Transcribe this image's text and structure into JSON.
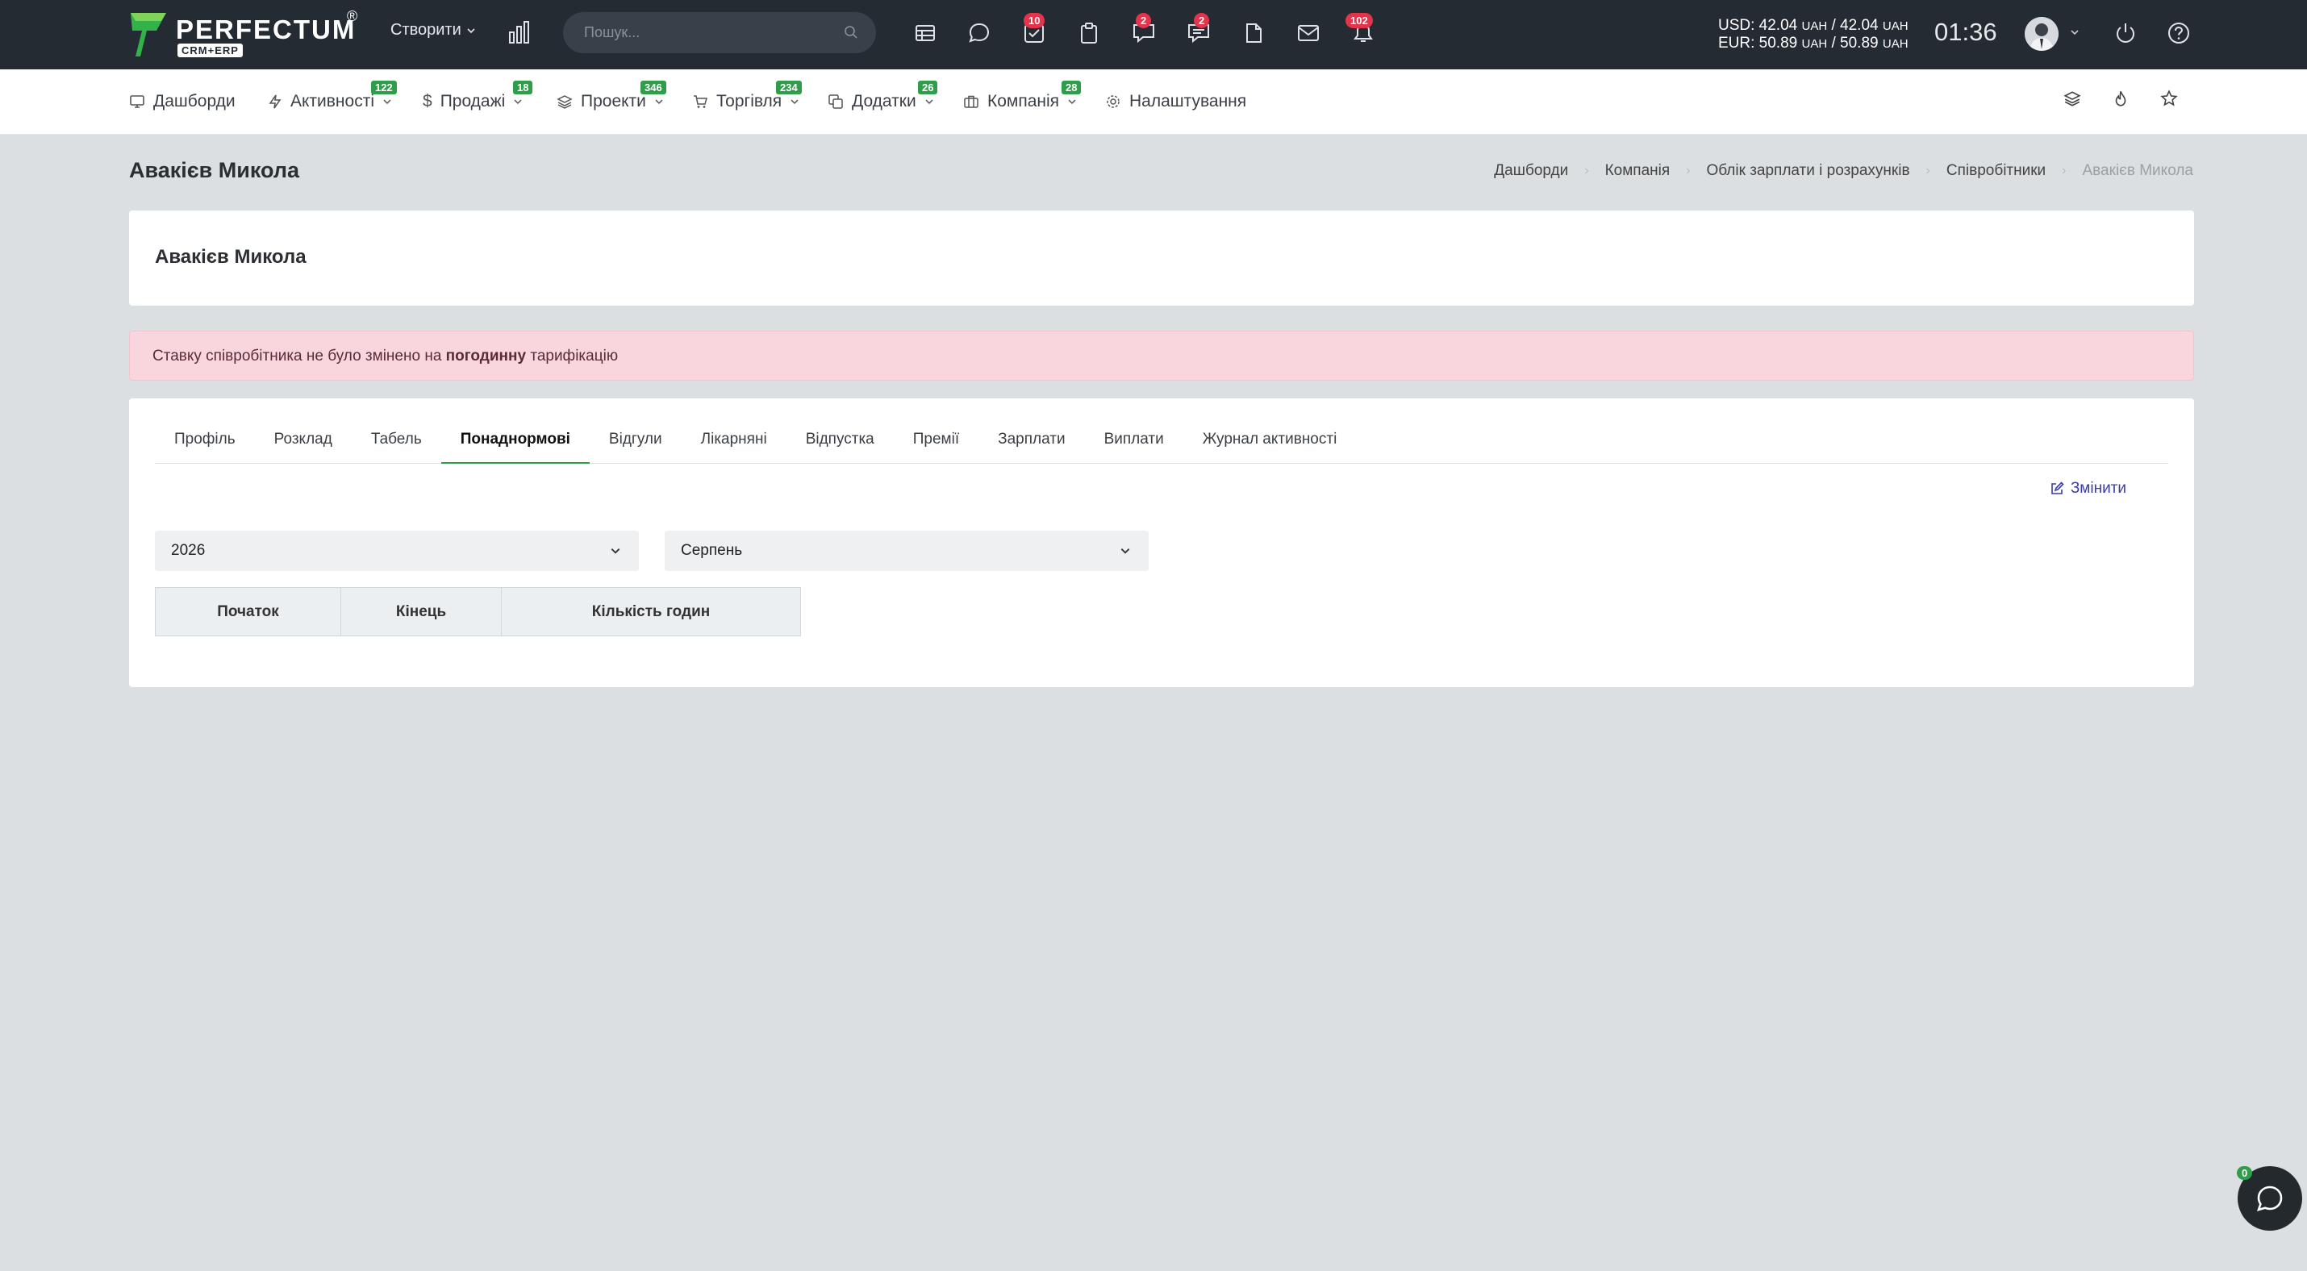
{
  "app": {
    "logo_text": "PERFECTUM",
    "logo_sub": "CRM+ERP",
    "logo_reg": "®",
    "create_label": "Створити",
    "search_placeholder": "Пошук...",
    "badges": {
      "tasks": "10",
      "messages": "2",
      "chat": "2",
      "notifications": "102"
    },
    "rates": {
      "usd_label": "USD: 42.04",
      "usd_unit1": "UAH",
      "usd_sep": "/ 42.04",
      "usd_unit2": "UAH",
      "eur_label": "EUR: 50.89",
      "eur_unit1": "UAH",
      "eur_sep": "/ 50.89",
      "eur_unit2": "UAH"
    },
    "time": "01:36",
    "colors": {
      "topbar": "#242b33",
      "accent_green": "#2e9e4a",
      "badge_red": "#e5334b"
    }
  },
  "nav": [
    {
      "label": "Дашборди",
      "icon": "monitor-icon",
      "badge": ""
    },
    {
      "label": "Активності",
      "icon": "bolt-icon",
      "badge": "122"
    },
    {
      "label": "Продажі",
      "icon": "dollar-icon",
      "badge": "18"
    },
    {
      "label": "Проекти",
      "icon": "layers-icon",
      "badge": "346"
    },
    {
      "label": "Торгівля",
      "icon": "cart-icon",
      "badge": "234"
    },
    {
      "label": "Додатки",
      "icon": "copy-icon",
      "badge": "26"
    },
    {
      "label": "Компанія",
      "icon": "briefcase-icon",
      "badge": "28"
    },
    {
      "label": "Налаштування",
      "icon": "gear-icon",
      "badge": ""
    }
  ],
  "page": {
    "title": "Авакієв Микола",
    "breadcrumb": [
      "Дашборди",
      "Компанія",
      "Облік зарплати і розрахунків",
      "Співробітники",
      "Авакієв Микола"
    ],
    "card_name": "Авакієв Микола",
    "alert": {
      "before": "Ставку співробітника не було змінено на ",
      "bold": "погодинну",
      "after": " тарифікацію"
    },
    "tabs": [
      "Профіль",
      "Розклад",
      "Табель",
      "Понаднормові",
      "Відгули",
      "Лікарняні",
      "Відпустка",
      "Премії",
      "Зарплати",
      "Виплати",
      "Журнал активності"
    ],
    "active_tab": "Понаднормові",
    "edit_label": "Змінити",
    "year_select": "2026",
    "month_select": "Серпень",
    "table_headers": [
      "Початок",
      "Кінець",
      "Кількість годин"
    ]
  },
  "chat_badge": "0"
}
